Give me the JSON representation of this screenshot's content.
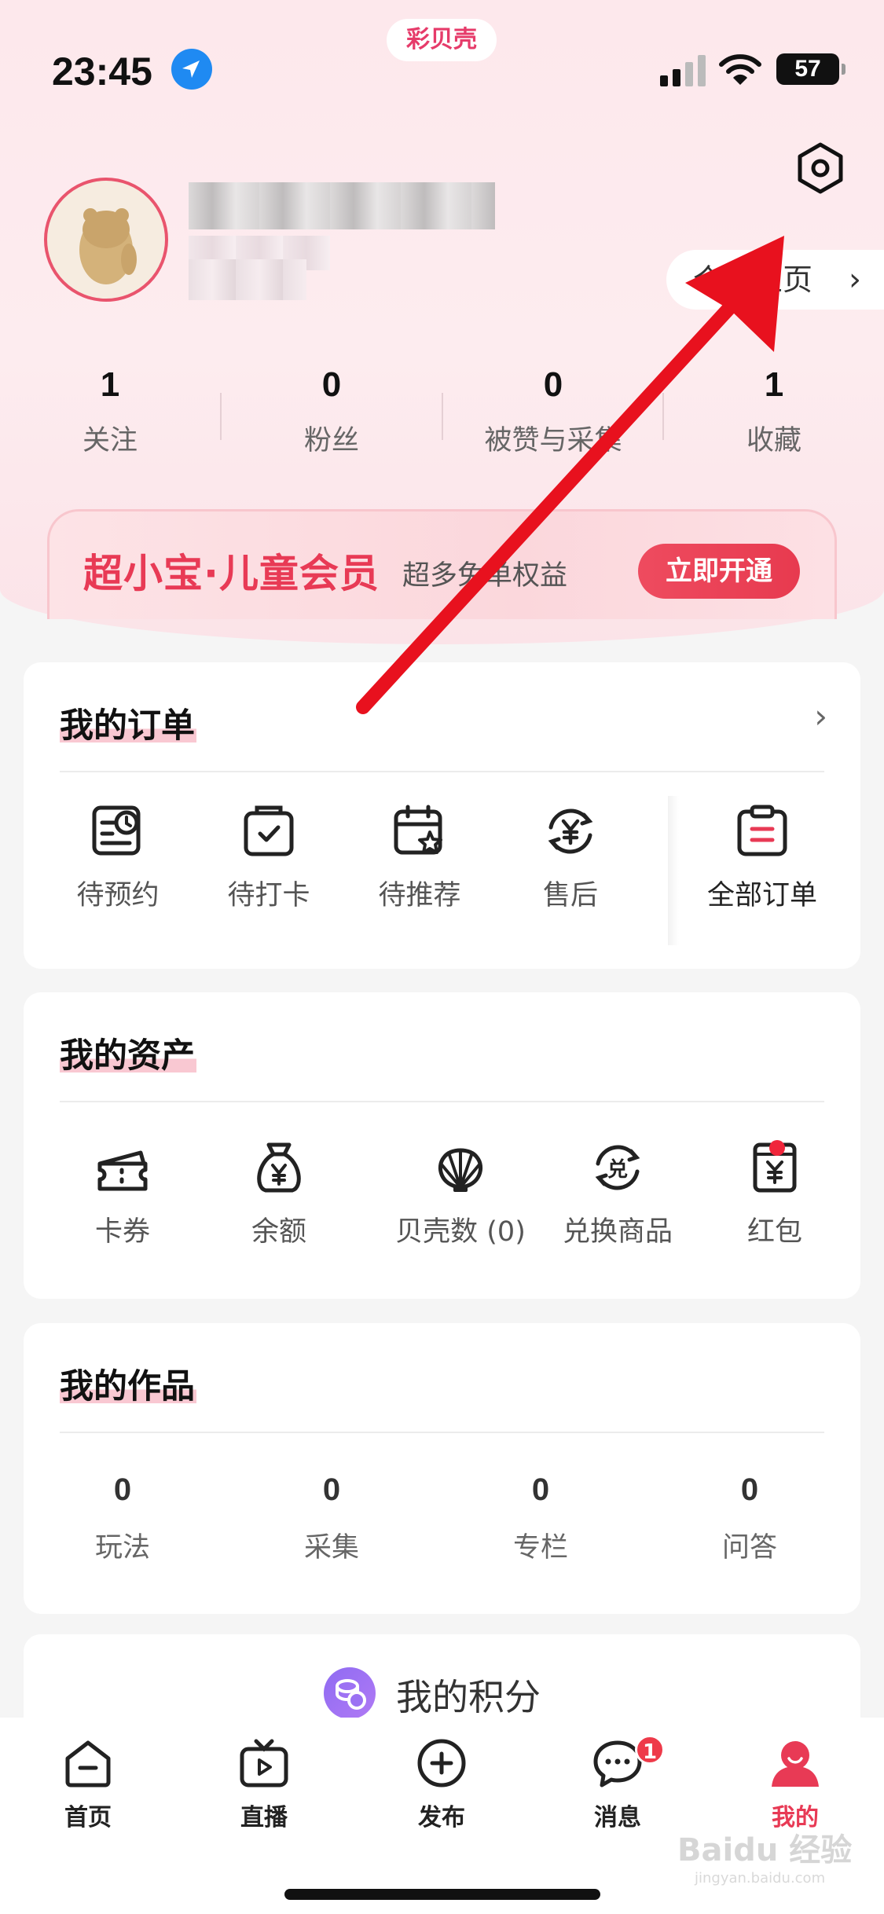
{
  "status_bar": {
    "time": "23:45",
    "battery": "57"
  },
  "app_badge": "彩贝壳",
  "profile": {
    "homepage_label": "个人主页"
  },
  "stats": [
    {
      "num": "1",
      "label": "关注"
    },
    {
      "num": "0",
      "label": "粉丝"
    },
    {
      "num": "0",
      "label": "被赞与采集"
    },
    {
      "num": "1",
      "label": "收藏"
    }
  ],
  "vip": {
    "title": "超小宝·儿童会员",
    "subtitle": "超多免单权益",
    "button": "立即开通"
  },
  "orders": {
    "title": "我的订单",
    "items": [
      {
        "label": "待预约",
        "icon": "appointment-icon"
      },
      {
        "label": "待打卡",
        "icon": "checkin-icon"
      },
      {
        "label": "待推荐",
        "icon": "recommend-icon"
      },
      {
        "label": "售后",
        "icon": "after-sales-icon"
      },
      {
        "label": "全部订单",
        "icon": "all-orders-icon"
      }
    ]
  },
  "assets": {
    "title": "我的资产",
    "items": [
      {
        "label": "卡券",
        "icon": "coupon-icon"
      },
      {
        "label": "余额",
        "icon": "money-bag-icon"
      },
      {
        "label": "贝壳数 (0)",
        "icon": "shell-icon"
      },
      {
        "label": "兑换商品",
        "icon": "exchange-icon"
      },
      {
        "label": "红包",
        "icon": "red-packet-icon"
      }
    ]
  },
  "works": {
    "title": "我的作品",
    "items": [
      {
        "num": "0",
        "label": "玩法"
      },
      {
        "num": "0",
        "label": "采集"
      },
      {
        "num": "0",
        "label": "专栏"
      },
      {
        "num": "0",
        "label": "问答"
      }
    ]
  },
  "points": {
    "label": "我的积分"
  },
  "tabbar": {
    "items": [
      {
        "label": "首页",
        "icon": "home-icon"
      },
      {
        "label": "直播",
        "icon": "live-tv-icon"
      },
      {
        "label": "发布",
        "icon": "publish-plus-icon"
      },
      {
        "label": "消息",
        "icon": "message-icon",
        "badge": "1"
      },
      {
        "label": "我的",
        "icon": "profile-icon",
        "active": true
      }
    ]
  },
  "watermark": {
    "text": "Baidu 经验",
    "sub": "jingyan.baidu.com"
  },
  "colors": {
    "accent": "#e83a55",
    "hero_bg": "#fde8ec",
    "page_bg": "#f5f5f5"
  }
}
